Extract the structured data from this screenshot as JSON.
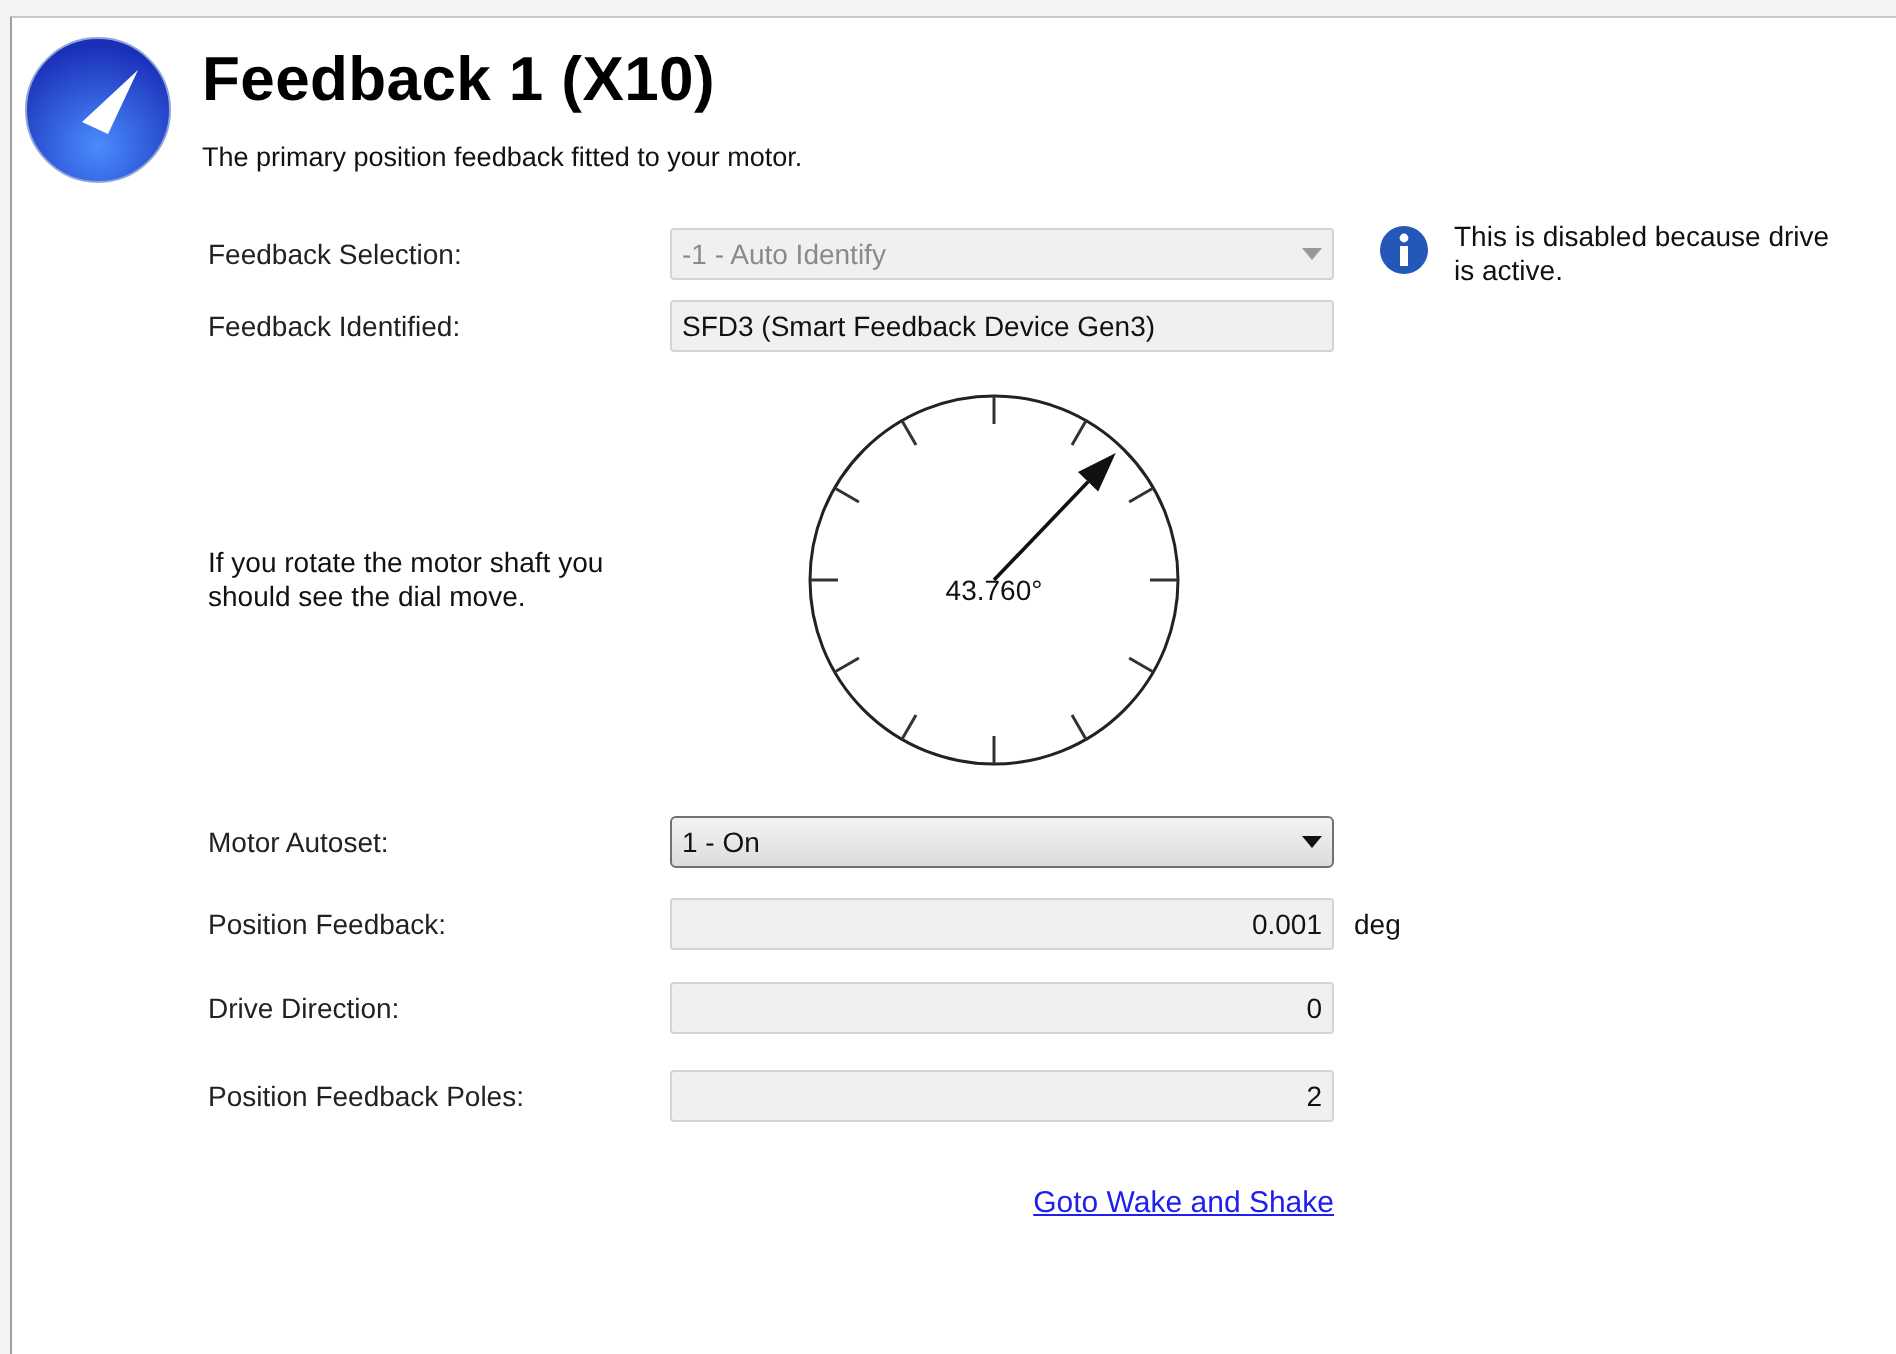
{
  "header": {
    "title": "Feedback 1 (X10)",
    "subtitle": "The primary position feedback fitted to your motor."
  },
  "feedback_selection": {
    "label": "Feedback Selection:",
    "value": "-1 - Auto Identify",
    "disabled": true
  },
  "info_note": "This is disabled because drive is active.",
  "feedback_identified": {
    "label": "Feedback Identified:",
    "value": "SFD3 (Smart Feedback Device Gen3)"
  },
  "dial": {
    "hint": "If you rotate the motor shaft you should see the dial move.",
    "reading": "43.760°"
  },
  "fields": [
    {
      "kind": "dropdown",
      "label": "Motor Autoset:",
      "value": "1 - On",
      "disabled": false
    },
    {
      "kind": "readout",
      "label": "Position Feedback:",
      "value": "0.001",
      "unit": "deg"
    },
    {
      "kind": "readout",
      "label": "Drive Direction:",
      "value": "0"
    },
    {
      "kind": "readout",
      "label": "Position Feedback Poles:",
      "value": "2"
    }
  ],
  "link": "Goto Wake and Shake"
}
